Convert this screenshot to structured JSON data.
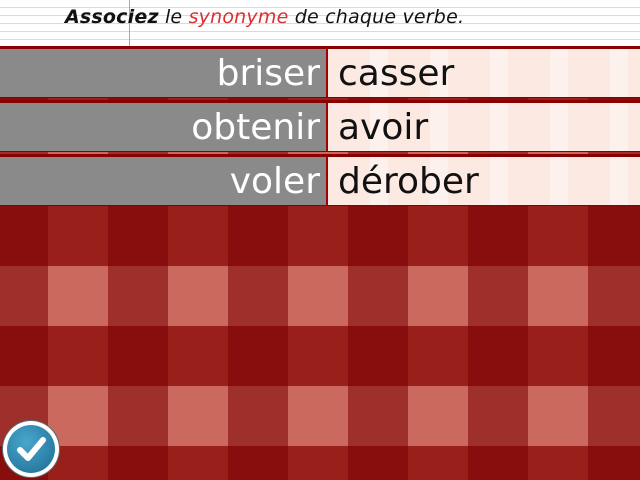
{
  "instruction": {
    "bold": "Associez",
    "part1": " le ",
    "highlight": "synonyme",
    "part2": " de chaque verbe."
  },
  "pairs": [
    {
      "verb": "briser",
      "synonym": "casser"
    },
    {
      "verb": "obtenir",
      "synonym": "avoir"
    },
    {
      "verb": "voler",
      "synonym": "dérober"
    }
  ],
  "icons": {
    "check": "check-icon"
  },
  "colors": {
    "highlight": "#d93030",
    "verb_cell": "#8a8a8a",
    "synonym_cell": "#fbe9e2",
    "background": "#c0483a",
    "check_button": "#2a86b0"
  }
}
